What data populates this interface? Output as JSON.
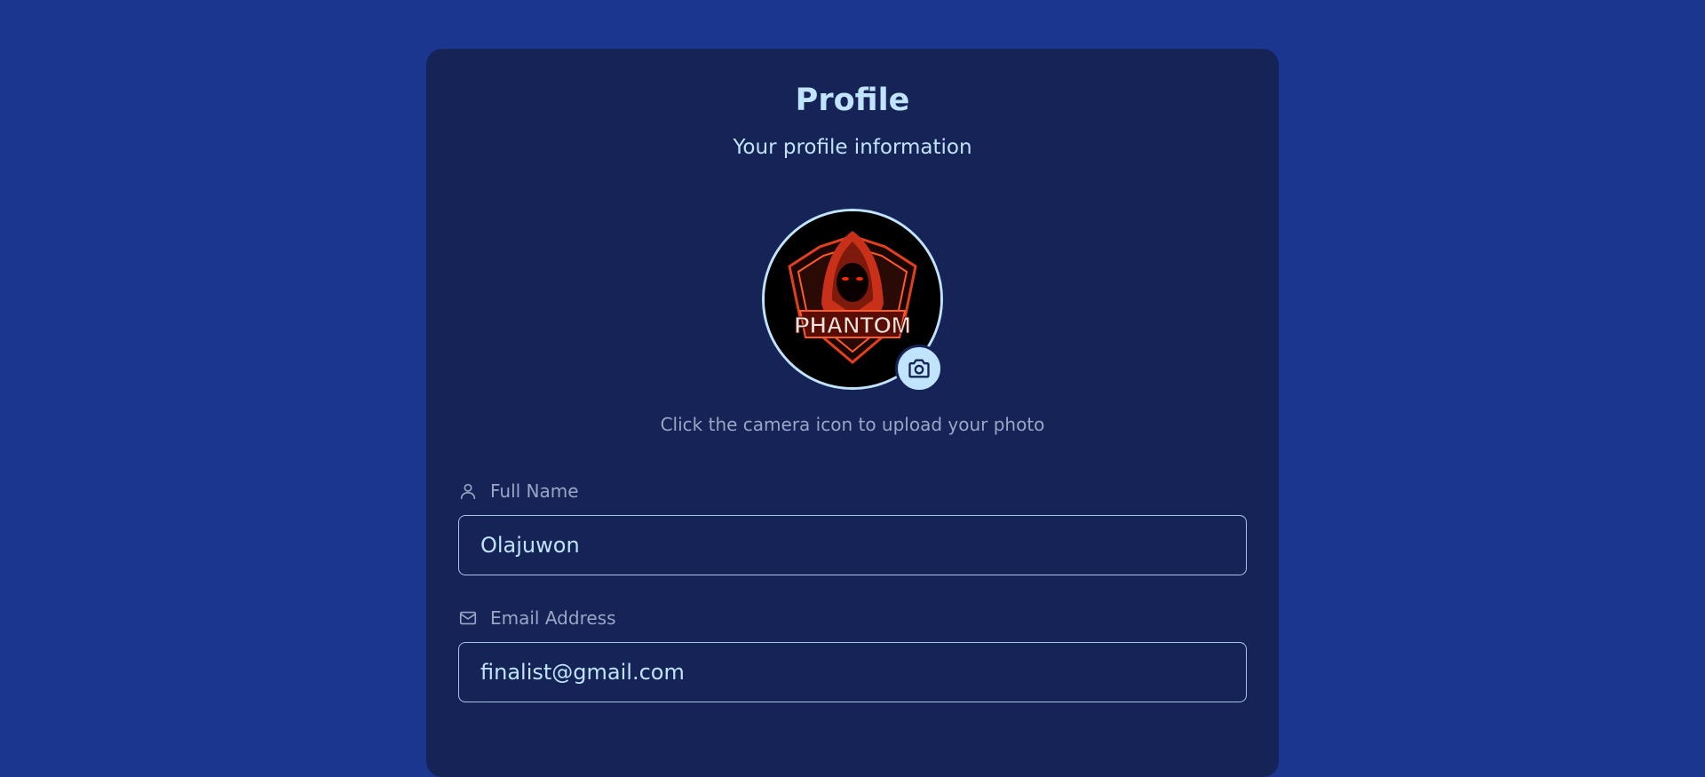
{
  "profile": {
    "title": "Profile",
    "subtitle": "Your profile information",
    "avatar_text": "PHANTOM",
    "hint": "Click the camera icon to upload your photo"
  },
  "fields": {
    "full_name": {
      "label": "Full Name",
      "value": "Olajuwon"
    },
    "email": {
      "label": "Email Address",
      "value": "finalist@gmail.com"
    }
  },
  "icons": {
    "camera": "camera-icon",
    "user": "user-icon",
    "mail": "mail-icon"
  },
  "colors": {
    "page_background": "#1a368e",
    "card_background": "#162357",
    "accent": "#bfe4fb",
    "muted_text": "#9aa6c3"
  }
}
